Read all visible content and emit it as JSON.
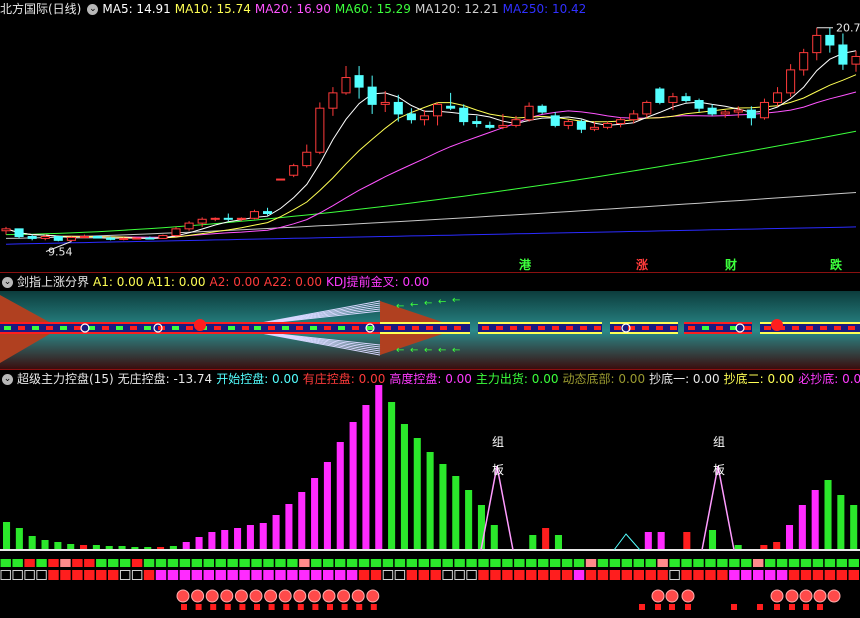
{
  "colors": {
    "up": "#ff3b3b",
    "down": "#54ffff",
    "ma5": "#ffffff",
    "ma10": "#ffff54",
    "ma20": "#ff54ff",
    "ma60": "#3cff3c",
    "ma120": "#c8c8c8",
    "ma250": "#2b2bff",
    "green": "#2be82b",
    "magenta": "#ff2bff",
    "red": "#ff1e1e"
  },
  "pane1": {
    "title": "北方国际(日线)",
    "icon": "chevron-circle-icon",
    "ma": [
      {
        "label": "MA5: 14.91",
        "color": "#ffffff"
      },
      {
        "label": "MA10: 15.74",
        "color": "#ffff54"
      },
      {
        "label": "MA20: 16.90",
        "color": "#ff54ff"
      },
      {
        "label": "MA60: 15.29",
        "color": "#3cff3c"
      },
      {
        "label": "MA120: 12.21",
        "color": "#d0d0d0"
      },
      {
        "label": "MA250: 10.42",
        "color": "#3030ff"
      }
    ],
    "high_label": "20.7",
    "low_label": "9.54",
    "tags": [
      "港",
      "涨",
      "财",
      "跌"
    ],
    "candles": [
      [
        10.1,
        10.3,
        9.9,
        10.2
      ],
      [
        10.2,
        10.2,
        9.7,
        9.8
      ],
      [
        9.8,
        9.9,
        9.6,
        9.7
      ],
      [
        9.7,
        9.9,
        9.6,
        9.8
      ],
      [
        9.8,
        9.8,
        9.55,
        9.6
      ],
      [
        9.6,
        9.8,
        9.54,
        9.75
      ],
      [
        9.75,
        9.9,
        9.7,
        9.8
      ],
      [
        9.8,
        9.85,
        9.7,
        9.72
      ],
      [
        9.72,
        9.8,
        9.6,
        9.65
      ],
      [
        9.65,
        9.75,
        9.6,
        9.7
      ],
      [
        9.7,
        9.75,
        9.65,
        9.72
      ],
      [
        9.72,
        9.8,
        9.65,
        9.7
      ],
      [
        9.7,
        9.9,
        9.68,
        9.85
      ],
      [
        9.85,
        10.3,
        9.8,
        10.2
      ],
      [
        10.2,
        10.6,
        10.1,
        10.5
      ],
      [
        10.5,
        10.8,
        10.3,
        10.7
      ],
      [
        10.7,
        10.8,
        10.6,
        10.75
      ],
      [
        10.75,
        11.0,
        10.6,
        10.7
      ],
      [
        10.7,
        10.8,
        10.6,
        10.75
      ],
      [
        10.75,
        11.2,
        10.7,
        11.1
      ],
      [
        11.1,
        11.3,
        10.9,
        11.0
      ],
      [
        12.8,
        12.8,
        12.8,
        12.8
      ],
      [
        13.0,
        13.6,
        12.9,
        13.5
      ],
      [
        13.5,
        14.6,
        13.4,
        14.2
      ],
      [
        14.2,
        16.8,
        14.1,
        16.5
      ],
      [
        16.5,
        17.6,
        16.1,
        17.3
      ],
      [
        17.3,
        18.7,
        17.2,
        18.1
      ],
      [
        18.2,
        18.7,
        17.0,
        17.6
      ],
      [
        17.6,
        18.2,
        16.2,
        16.7
      ],
      [
        16.7,
        17.4,
        16.3,
        16.8
      ],
      [
        16.8,
        17.2,
        15.8,
        16.2
      ],
      [
        16.2,
        16.5,
        15.7,
        15.9
      ],
      [
        15.9,
        16.4,
        15.6,
        16.1
      ],
      [
        16.1,
        16.8,
        15.6,
        16.7
      ],
      [
        16.6,
        17.3,
        16.4,
        16.5
      ],
      [
        16.5,
        16.7,
        15.6,
        15.8
      ],
      [
        15.8,
        16.1,
        15.5,
        15.7
      ],
      [
        15.6,
        15.8,
        15.4,
        15.5
      ],
      [
        15.5,
        16.2,
        15.4,
        15.6
      ],
      [
        15.6,
        16.1,
        15.5,
        15.9
      ],
      [
        15.9,
        16.8,
        15.8,
        16.6
      ],
      [
        16.6,
        16.7,
        16.2,
        16.3
      ],
      [
        16.1,
        16.3,
        15.5,
        15.6
      ],
      [
        15.6,
        15.9,
        15.4,
        15.8
      ],
      [
        15.8,
        15.9,
        15.2,
        15.4
      ],
      [
        15.4,
        15.8,
        15.3,
        15.5
      ],
      [
        15.5,
        15.8,
        15.4,
        15.7
      ],
      [
        15.7,
        16.0,
        15.5,
        15.9
      ],
      [
        15.9,
        16.4,
        15.7,
        16.2
      ],
      [
        16.2,
        16.9,
        16.0,
        16.8
      ],
      [
        17.5,
        17.6,
        16.7,
        16.8
      ],
      [
        16.8,
        17.3,
        16.4,
        17.1
      ],
      [
        17.1,
        17.3,
        16.8,
        16.9
      ],
      [
        16.9,
        17.0,
        16.3,
        16.5
      ],
      [
        16.5,
        16.7,
        16.1,
        16.2
      ],
      [
        16.2,
        16.4,
        16.0,
        16.3
      ],
      [
        16.3,
        16.6,
        16.0,
        16.4
      ],
      [
        16.4,
        16.6,
        15.6,
        16.0
      ],
      [
        16.0,
        17.0,
        15.9,
        16.8
      ],
      [
        16.8,
        17.6,
        16.6,
        17.3
      ],
      [
        17.3,
        18.8,
        17.1,
        18.5
      ],
      [
        18.5,
        19.6,
        18.2,
        19.4
      ],
      [
        19.4,
        20.7,
        19.0,
        20.3
      ],
      [
        20.3,
        20.7,
        19.4,
        19.8
      ],
      [
        19.8,
        20.4,
        18.5,
        18.8
      ],
      [
        18.8,
        19.5,
        18.4,
        19.2
      ]
    ]
  },
  "pane2": {
    "title": "剑指上涨分界",
    "items": [
      {
        "label": "A1: 0.00",
        "color": "#ffff54"
      },
      {
        "label": "A11: 0.00",
        "color": "#ffff54"
      },
      {
        "label": "A2: 0.00",
        "color": "#ff3b3b"
      },
      {
        "label": "A22: 0.00",
        "color": "#ff3b3b"
      },
      {
        "label": "KDJ提前金叉: 0.00",
        "color": "#ff3bff"
      }
    ]
  },
  "pane3": {
    "title": "超级主力控盘(15)",
    "items": [
      {
        "label": "无庄控盘: -13.74",
        "color": "#e8e8e8"
      },
      {
        "label": "开始控盘: 0.00",
        "color": "#54ffff"
      },
      {
        "label": "有庄控盘: 0.00",
        "color": "#ff3b3b"
      },
      {
        "label": "高度控盘: 0.00",
        "color": "#ff3bff"
      },
      {
        "label": "主力出货: 0.00",
        "color": "#3cff3c"
      },
      {
        "label": "动态底部: 0.00",
        "color": "#9a9a30"
      },
      {
        "label": "抄底一: 0.00",
        "color": "#e8e8e8"
      },
      {
        "label": "抄底二: 0.00",
        "color": "#ffff54"
      },
      {
        "label": "必抄底: 0.00",
        "color": "#ff3bff"
      },
      {
        "label": "深控",
        "color": "#e8e8e8"
      }
    ],
    "marks": [
      "组",
      "板"
    ],
    "bars": [
      [
        28,
        "g"
      ],
      [
        22,
        "g"
      ],
      [
        14,
        "g"
      ],
      [
        10,
        "g"
      ],
      [
        8,
        "g"
      ],
      [
        6,
        "g"
      ],
      [
        5,
        "r"
      ],
      [
        5,
        "g"
      ],
      [
        4,
        "g"
      ],
      [
        4,
        "g"
      ],
      [
        3,
        "g"
      ],
      [
        3,
        "g"
      ],
      [
        3,
        "r"
      ],
      [
        4,
        "g"
      ],
      [
        8,
        "m"
      ],
      [
        13,
        "m"
      ],
      [
        18,
        "m"
      ],
      [
        20,
        "m"
      ],
      [
        22,
        "m"
      ],
      [
        25,
        "m"
      ],
      [
        27,
        "m"
      ],
      [
        35,
        "m"
      ],
      [
        46,
        "m"
      ],
      [
        58,
        "m"
      ],
      [
        72,
        "m"
      ],
      [
        88,
        "m"
      ],
      [
        108,
        "m"
      ],
      [
        128,
        "m"
      ],
      [
        145,
        "m"
      ],
      [
        165,
        "m"
      ],
      [
        148,
        "g"
      ],
      [
        126,
        "g"
      ],
      [
        112,
        "g"
      ],
      [
        98,
        "g"
      ],
      [
        86,
        "g"
      ],
      [
        74,
        "g"
      ],
      [
        60,
        "g"
      ],
      [
        45,
        "g"
      ],
      [
        25,
        "g"
      ],
      [
        0,
        "g"
      ],
      [
        0,
        "g"
      ],
      [
        15,
        "g"
      ],
      [
        22,
        "r"
      ],
      [
        15,
        "g"
      ],
      [
        0,
        "g"
      ],
      [
        0,
        "g"
      ],
      [
        0,
        "g"
      ],
      [
        0,
        "g"
      ],
      [
        0,
        "g"
      ],
      [
        0,
        "g"
      ],
      [
        18,
        "m"
      ],
      [
        18,
        "m"
      ],
      [
        0,
        "g"
      ],
      [
        18,
        "r"
      ],
      [
        0,
        "g"
      ],
      [
        20,
        "g"
      ],
      [
        0,
        "g"
      ],
      [
        5,
        "g"
      ],
      [
        0,
        "g"
      ],
      [
        5,
        "r"
      ],
      [
        8,
        "r"
      ],
      [
        25,
        "m"
      ],
      [
        45,
        "m"
      ],
      [
        60,
        "m"
      ],
      [
        70,
        "g"
      ],
      [
        55,
        "g"
      ],
      [
        45,
        "g"
      ]
    ]
  }
}
